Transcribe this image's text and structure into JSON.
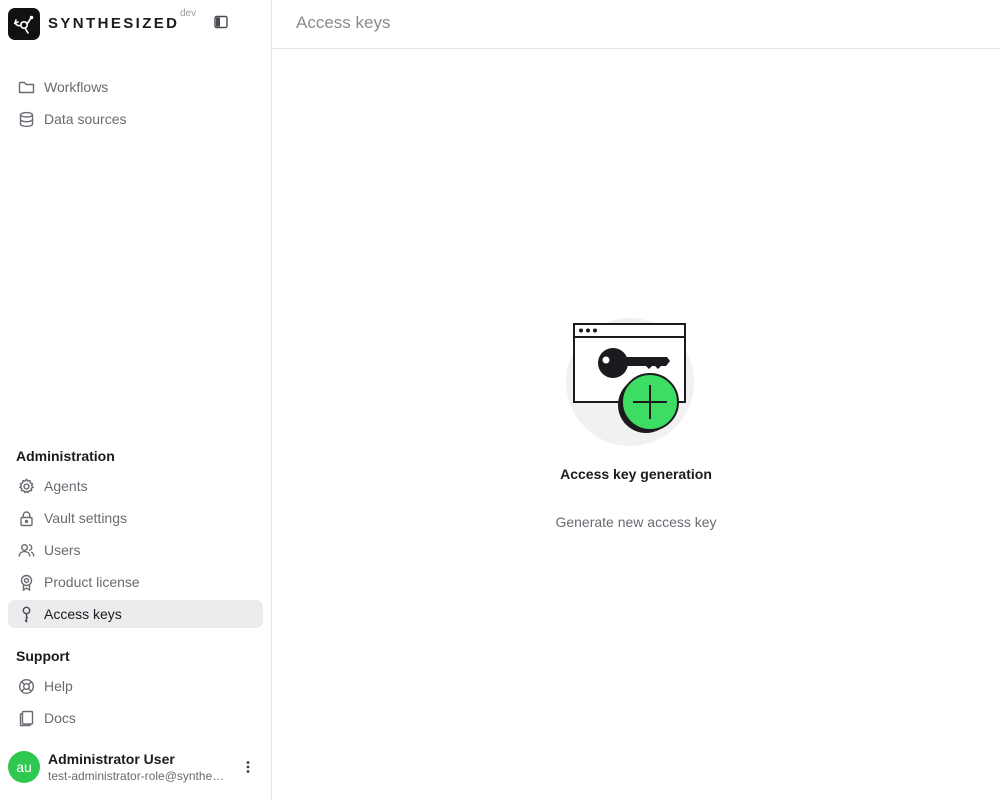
{
  "brand": {
    "name": "SYNTHESIZED",
    "env": "dev"
  },
  "header": {
    "title": "Access keys"
  },
  "sidebar": {
    "main_items": [
      {
        "label": "Workflows",
        "icon": "folder-icon"
      },
      {
        "label": "Data sources",
        "icon": "database-icon"
      }
    ],
    "administration_title": "Administration",
    "administration_items": [
      {
        "label": "Agents",
        "icon": "gear-icon"
      },
      {
        "label": "Vault settings",
        "icon": "lock-icon"
      },
      {
        "label": "Users",
        "icon": "users-icon"
      },
      {
        "label": "Product license",
        "icon": "award-icon"
      },
      {
        "label": "Access keys",
        "icon": "key-icon",
        "active": true
      }
    ],
    "support_title": "Support",
    "support_items": [
      {
        "label": "Help",
        "icon": "lifebuoy-icon"
      },
      {
        "label": "Docs",
        "icon": "docs-icon"
      }
    ]
  },
  "user": {
    "initials": "au",
    "name": "Administrator User",
    "email": "test-administrator-role@synthesized.io",
    "avatar_color": "#2fc851"
  },
  "empty_state": {
    "title": "Access key generation",
    "action": "Generate new access key",
    "accent": "#3ddc63"
  }
}
